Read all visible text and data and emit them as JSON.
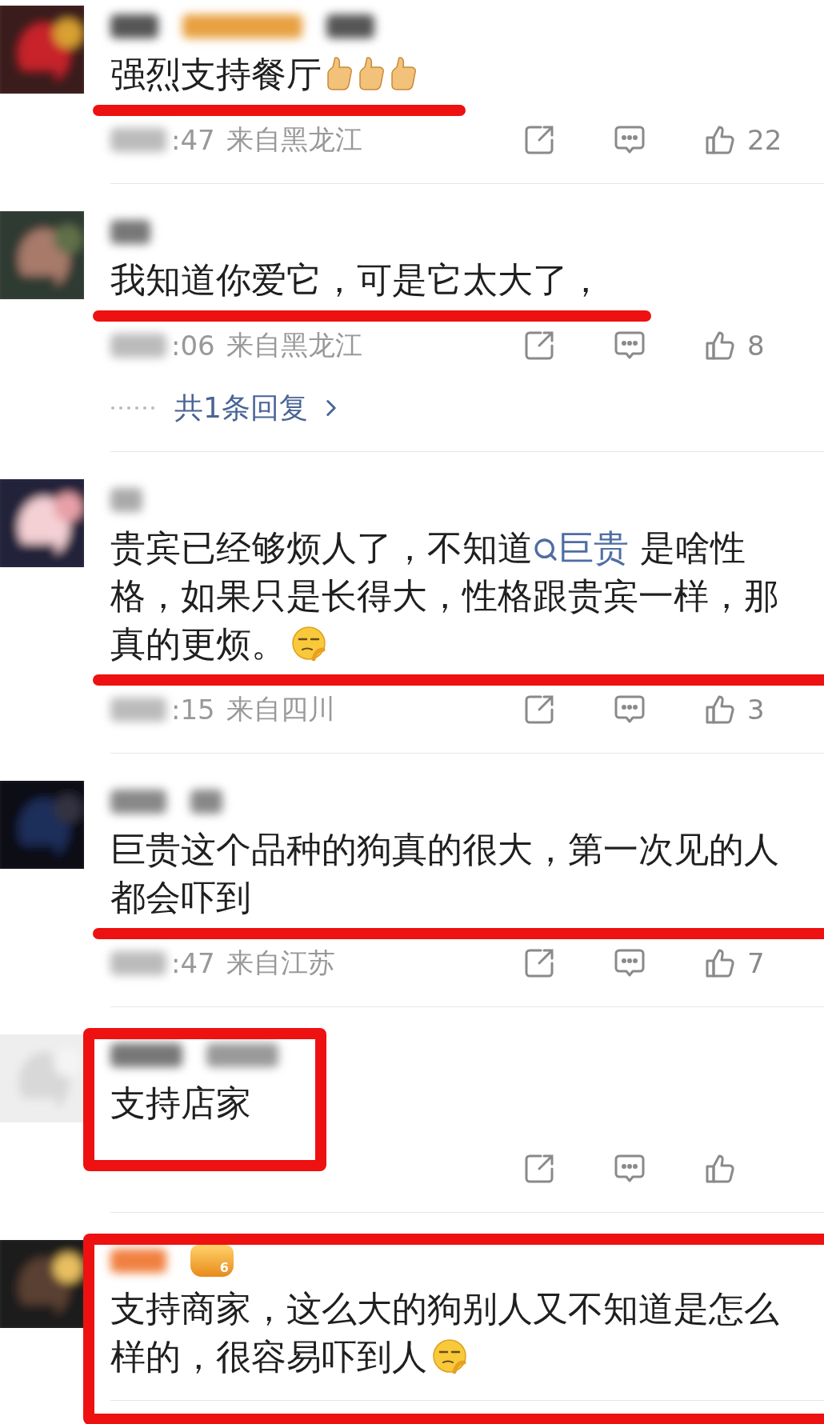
{
  "comments": [
    {
      "text": [
        {
          "kind": "text",
          "text": "强烈支持餐厅"
        },
        {
          "kind": "thumb-emoji"
        },
        {
          "kind": "thumb-emoji"
        },
        {
          "kind": "thumb-emoji"
        }
      ],
      "underlined": true,
      "boxed": false,
      "actions": true,
      "time": ":47",
      "location": "来自黑龙江",
      "likes": "22"
    },
    {
      "text": [
        {
          "kind": "text",
          "text": "我知道你爱它，可是它太大了，"
        }
      ],
      "underlined": true,
      "boxed": false,
      "actions": true,
      "time": ":06",
      "location": "来自黑龙江",
      "likes": "8",
      "replies": "共1条回复"
    },
    {
      "text": [
        {
          "kind": "text",
          "text": "贵宾已经够烦人了，不知道"
        },
        {
          "kind": "topic",
          "text": "巨贵"
        },
        {
          "kind": "text",
          "text": "是啥性格，如果只是长得大，性格跟贵宾一样，那真的更烦。"
        },
        {
          "kind": "smirk-emoji"
        }
      ],
      "underlined": true,
      "boxed": false,
      "actions": true,
      "time": ":15",
      "location": "来自四川",
      "likes": "3"
    },
    {
      "text": [
        {
          "kind": "text",
          "text": "巨贵这个品种的狗真的很大，第一次见的人都会吓到"
        }
      ],
      "underlined": true,
      "boxed": false,
      "actions": true,
      "time": ":47",
      "location": "来自江苏",
      "likes": "7"
    },
    {
      "text": [
        {
          "kind": "text",
          "text": "支持店家"
        }
      ],
      "underlined": false,
      "boxed": true,
      "actions": true
    },
    {
      "text": [
        {
          "kind": "text",
          "text": "支持商家，这么大的狗别人又不知道是怎么样的，很容易吓到人"
        },
        {
          "kind": "smirk-emoji"
        }
      ],
      "underlined": false,
      "boxed": true,
      "actions": false,
      "badge": "6"
    }
  ]
}
